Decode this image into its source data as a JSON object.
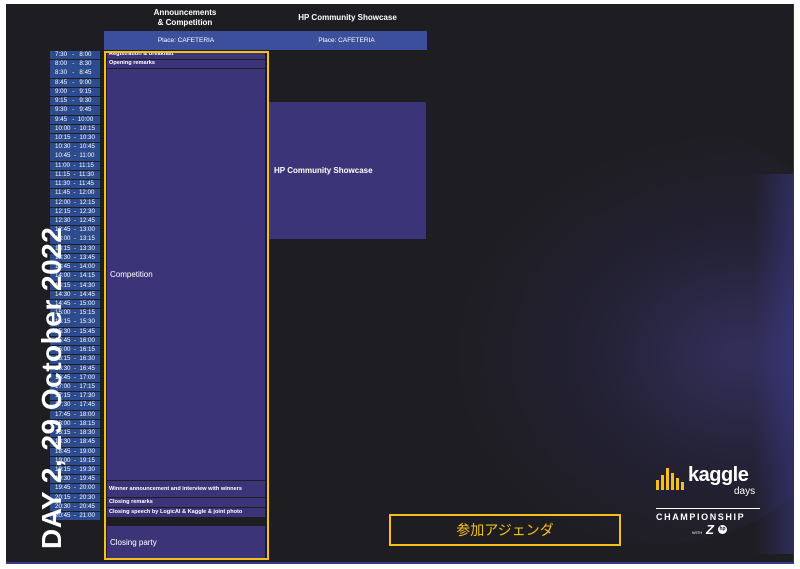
{
  "headers": {
    "col1": "Announcements\n& Competition",
    "col2": "HP Community Showcase"
  },
  "places": {
    "col1": "Place: CAFETERIA",
    "col2": "Place: CAFETERIA"
  },
  "times": [
    "7:30   -   8:00",
    "8:00   -   8:30",
    "8:30   -   8:45",
    "8:45   -   9:00",
    "9:00   -   9:15",
    "9:15   -   9:30",
    "9:30   -   9:45",
    "9:45   -  10:00",
    "10:00  -  10:15",
    "10:15  -  10:30",
    "10:30  -  10:45",
    "10:45  -  11:00",
    "11:00  -  11:15",
    "11:15  -  11:30",
    "11:30  -  11:45",
    "11:45  -  12:00",
    "12:00  -  12:15",
    "12:15  -  12:30",
    "12:30  -  12:45",
    "12:45  -  13:00",
    "13:00  -  13:15",
    "13:15  -  13:30",
    "13:30  -  13:45",
    "13:45  -  14:00",
    "14:00  -  14:15",
    "14:15  -  14:30",
    "14:30  -  14:45",
    "14:45  -  15:00",
    "15:00  -  15:15",
    "15:15  -  15:30",
    "15:30  -  15:45",
    "15:45  -  16:00",
    "16:00  -  16:15",
    "16:15  -  16:30",
    "16:30  -  16:45",
    "16:45  -  17:00",
    "17:00  -  17:15",
    "17:15  -  17:30",
    "17:30  -  17:45",
    "17:45  -  18:00",
    "18:00  -  18:15",
    "18:15  -  18:30",
    "18:30  -  18:45",
    "18:45  -  19:00",
    "19:00  -  19:15",
    "19:15  -  19:30",
    "19:30  -  19:45",
    "19:45  -  20:00",
    "20:15  -  20:30",
    "20:30  -  20:45",
    "20:45  -  21:00"
  ],
  "events": {
    "registration": "Registration & breakfast",
    "opening": "Opening remarks",
    "competition": "Competition",
    "winner": "Winner announcement and interview with winners",
    "closing_remarks": "Closing remarks",
    "closing_speech": "Closing speech by LogicAI & Kaggle & joint photo",
    "closing_party": "Closing party",
    "showcase": "HP Community Showcase"
  },
  "day_title": "DAY  2, 29 October 2022",
  "jp_label": "参加アジェンダ",
  "logo": {
    "kaggle": "kaggle",
    "days": "days",
    "championship": "CHAMPIONSHIP",
    "with": "WITH",
    "z": "Z",
    "hp": "hp"
  },
  "colors": {
    "background": "#1e1d21",
    "time_cell": "#2d4b8f",
    "event_cell": "#3c3479",
    "place_bar": "#3c4f9c",
    "highlight": "#f6c01c"
  }
}
